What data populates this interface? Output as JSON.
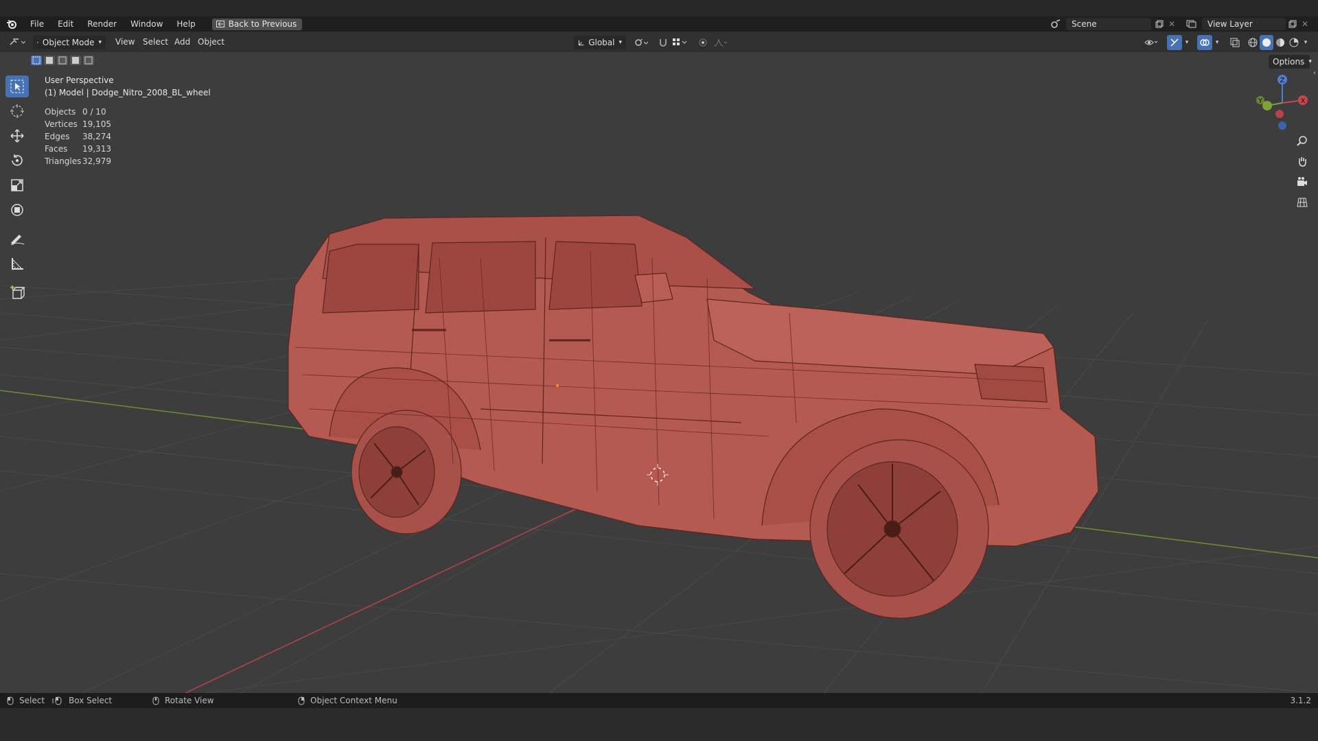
{
  "menubar": {
    "items": [
      "File",
      "Edit",
      "Render",
      "Window",
      "Help"
    ],
    "back_label": "Back to Previous",
    "scene_name": "Scene",
    "view_layer": "View Layer"
  },
  "header": {
    "mode": "Object Mode",
    "menus": [
      "View",
      "Select",
      "Add",
      "Object"
    ],
    "transform_orientation": "Global",
    "options_label": "Options"
  },
  "viewport": {
    "perspective": "User Perspective",
    "active_object": "(1) Model | Dodge_Nitro_2008_BL_wheel",
    "stats": [
      {
        "label": "Objects",
        "value": "0 / 10"
      },
      {
        "label": "Vertices",
        "value": "19,105"
      },
      {
        "label": "Edges",
        "value": "38,274"
      },
      {
        "label": "Faces",
        "value": "19,313"
      },
      {
        "label": "Triangles",
        "value": "32,979"
      }
    ],
    "gizmo": {
      "z": "Z",
      "y": "Y",
      "x": "X"
    },
    "colors": {
      "mesh": "#b55a50",
      "wire": "#5a2420",
      "x_axis": "#c9464e",
      "y_axis": "#7da23a",
      "active_tool": "#4772b3"
    }
  },
  "statusbar": {
    "select": "Select",
    "box_select": "Box Select",
    "rotate_view": "Rotate View",
    "context_menu": "Object Context Menu",
    "version": "3.1.2"
  }
}
